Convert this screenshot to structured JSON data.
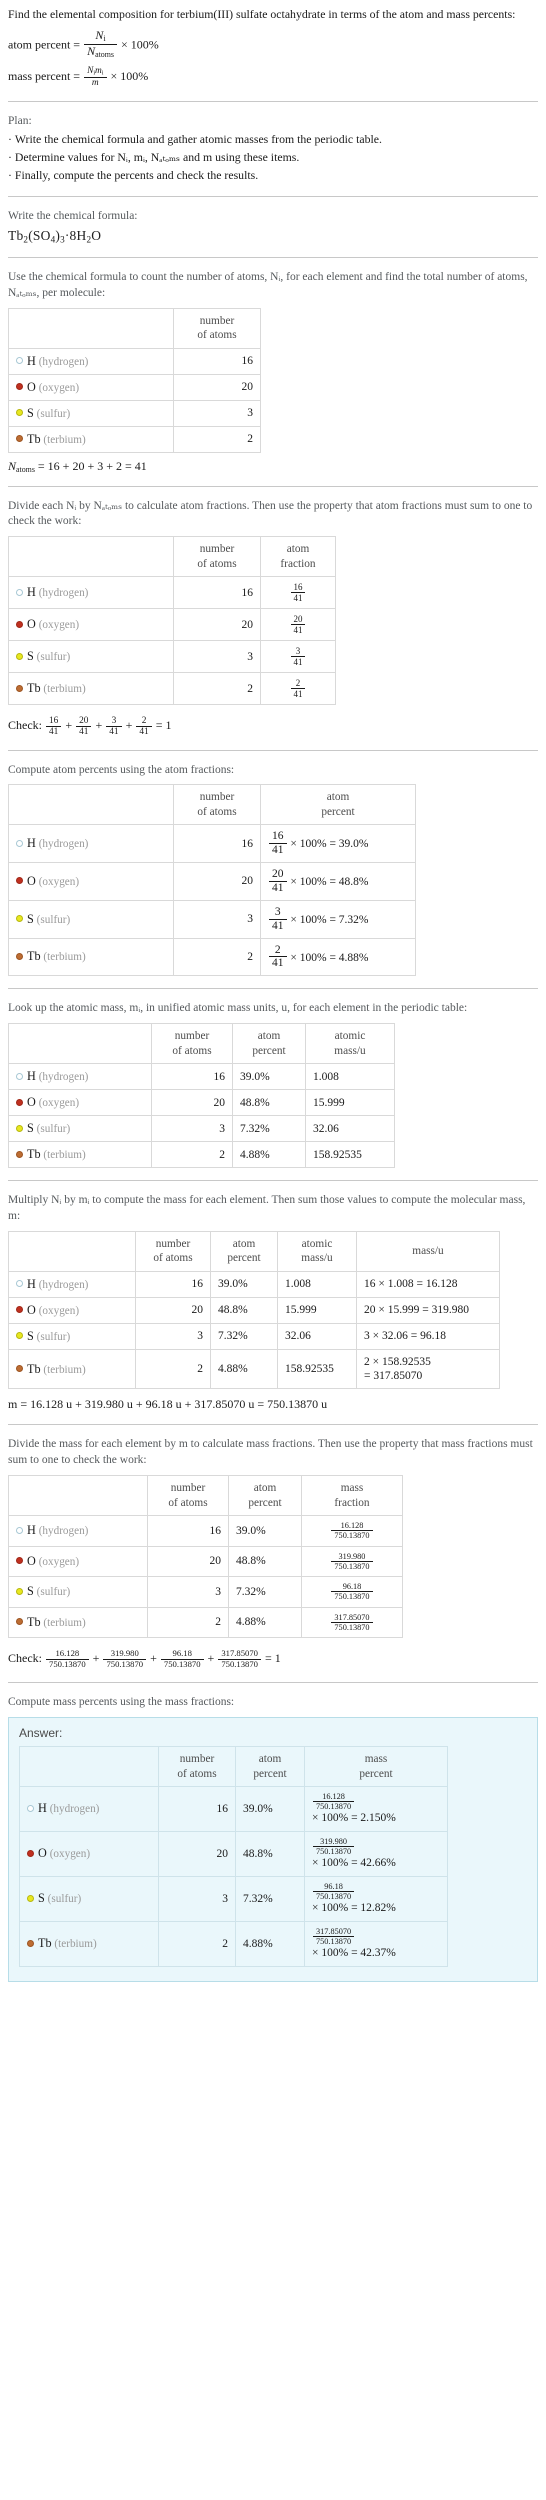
{
  "header": {
    "question": "Find the elemental composition for terbium(III) sulfate octahydrate in terms of the atom and mass percents:",
    "atom_percent_label": "atom percent =",
    "atom_percent_num": "N",
    "atom_percent_num_sub": "i",
    "atom_percent_den": "N",
    "atom_percent_den_sub": "atoms",
    "times_100": "× 100%",
    "mass_percent_label": "mass percent =",
    "mass_percent_num": "N",
    "mass_percent_num_sub": "i",
    "mass_percent_num2": "m",
    "mass_percent_num2_sub": "i",
    "mass_percent_den": "m"
  },
  "plan": {
    "title": "Plan:",
    "items": [
      "Write the chemical formula and gather atomic masses from the periodic table.",
      "Determine values for Nᵢ, mᵢ, Nₐₜₒₘₛ and m using these items.",
      "Finally, compute the percents and check the results."
    ]
  },
  "formula_section": {
    "prompt": "Write the chemical formula:",
    "formula_parts": [
      "Tb",
      "2",
      "(SO",
      "4",
      ")",
      "3",
      "·8H",
      "2",
      "O"
    ],
    "formula_plain": "Tb2(SO4)3·8H2O"
  },
  "count_section": {
    "prompt": "Use the chemical formula to count the number of atoms, Nᵢ, for each element and find the total number of atoms, Nₐₜₒₘₛ, per molecule:",
    "header_col1": "",
    "header_col2": [
      "number",
      "of atoms"
    ],
    "natoms_line": "N",
    "natoms_sub": "atoms",
    "natoms_expr": "= 16 + 20 + 3 + 2 = 41"
  },
  "fraction_section": {
    "prompt": "Divide each Nᵢ by Nₐₜₒₘₛ to calculate atom fractions. Then use the property that atom fractions must sum to one to check the work:",
    "header_col3": [
      "atom",
      "fraction"
    ],
    "check_label": "Check:",
    "check_result": "= 1"
  },
  "atom_percent_section": {
    "prompt": "Compute atom percents using the atom fractions:",
    "header_col3": [
      "atom",
      "percent"
    ]
  },
  "atomic_mass_section": {
    "prompt": "Look up the atomic mass, mᵢ, in unified atomic mass units, u, for each element in the periodic table:",
    "header_col4": [
      "atomic",
      "mass/u"
    ]
  },
  "mass_calc_section": {
    "prompt": "Multiply Nᵢ by mᵢ to compute the mass for each element. Then sum those values to compute the molecular mass, m:",
    "header_col5": "mass/u",
    "m_equation": "m = 16.128 u + 319.980 u + 96.18 u + 317.85070 u = 750.13870 u"
  },
  "mass_fraction_section": {
    "prompt": "Divide the mass for each element by m to calculate mass fractions. Then use the property that mass fractions must sum to one to check the work:",
    "header_col4": [
      "mass",
      "fraction"
    ],
    "check_label": "Check:",
    "check_result": "= 1"
  },
  "mass_percent_section": {
    "prompt": "Compute mass percents using the mass fractions:",
    "answer_label": "Answer:",
    "header_col4": [
      "mass",
      "percent"
    ]
  },
  "elements": [
    {
      "symbol": "H",
      "name": "(hydrogen)",
      "color": "#ffffff",
      "border": "#a8c8d4",
      "atoms": "16",
      "atom_fraction_num": "16",
      "atom_fraction_den": "41",
      "atom_percent_expr_tail": "× 100% = 39.0%",
      "atom_percent": "39.0%",
      "atomic_mass": "1.008",
      "mass_calc": "16 × 1.008 = 16.128",
      "mass_calc_l1": "16 × 1.008 = 16.128",
      "mass_calc_l2": "",
      "mass_value": "16.128",
      "mass_fraction_num": "16.128",
      "mass_fraction_den": "750.13870",
      "mass_percent_tail": "× 100% = 2.150%",
      "mass_percent": "2.150%"
    },
    {
      "symbol": "O",
      "name": "(oxygen)",
      "color": "#c03020",
      "border": "#a02818",
      "atoms": "20",
      "atom_fraction_num": "20",
      "atom_fraction_den": "41",
      "atom_percent_expr_tail": "× 100% = 48.8%",
      "atom_percent": "48.8%",
      "atomic_mass": "15.999",
      "mass_calc": "20 × 15.999 = 319.980",
      "mass_calc_l1": "20 × 15.999 = 319.980",
      "mass_calc_l2": "",
      "mass_value": "319.980",
      "mass_fraction_num": "319.980",
      "mass_fraction_den": "750.13870",
      "mass_percent_tail": "× 100% = 42.66%",
      "mass_percent": "42.66%"
    },
    {
      "symbol": "S",
      "name": "(sulfur)",
      "color": "#e8e820",
      "border": "#b8b810",
      "atoms": "3",
      "atom_fraction_num": "3",
      "atom_fraction_den": "41",
      "atom_percent_expr_tail": "× 100% = 7.32%",
      "atom_percent": "7.32%",
      "atomic_mass": "32.06",
      "mass_calc": "3 × 32.06 = 96.18",
      "mass_calc_l1": "3 × 32.06 = 96.18",
      "mass_calc_l2": "",
      "mass_value": "96.18",
      "mass_fraction_num": "96.18",
      "mass_fraction_den": "750.13870",
      "mass_percent_tail": "× 100% = 12.82%",
      "mass_percent": "12.82%"
    },
    {
      "symbol": "Tb",
      "name": "(terbium)",
      "color": "#bd6d33",
      "border": "#9d5523",
      "atoms": "2",
      "atom_fraction_num": "2",
      "atom_fraction_den": "41",
      "atom_percent_expr_tail": "× 100% = 4.88%",
      "atom_percent": "4.88%",
      "atomic_mass": "158.92535",
      "mass_calc": "2 × 158.92535 = 317.85070",
      "mass_calc_l1": "2 × 158.92535",
      "mass_calc_l2": "= 317.85070",
      "mass_value": "317.85070",
      "mass_fraction_num": "317.85070",
      "mass_fraction_den": "750.13870",
      "mass_percent_tail": "× 100% = 42.37%",
      "mass_percent": "42.37%"
    }
  ],
  "totals": {
    "natoms": "41",
    "molecular_mass": "750.13870"
  }
}
